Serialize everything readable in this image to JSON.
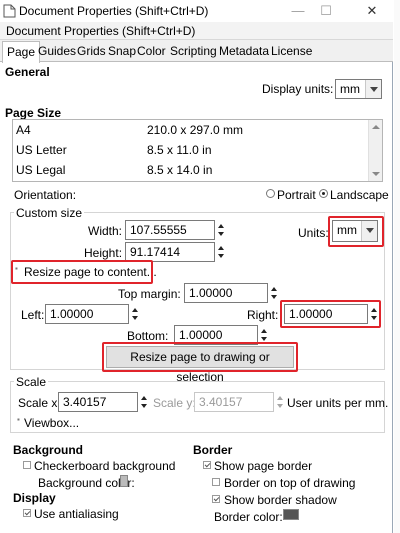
{
  "window": {
    "title": "Document Properties (Shift+Ctrl+D)",
    "subtitle": "Document Properties (Shift+Ctrl+D)",
    "minimize": "—",
    "maximize": "☐",
    "close": "✕"
  },
  "tabs": [
    "Page",
    "Guides",
    "Grids",
    "Snap",
    "Color",
    "Scripting",
    "Metadata",
    "License"
  ],
  "general": {
    "heading": "General",
    "display_units_label": "Display units:",
    "display_units_value": "mm"
  },
  "page_size": {
    "heading": "Page Size",
    "rows": [
      {
        "name": "A4",
        "size": "210.0 x 297.0 mm"
      },
      {
        "name": "US Letter",
        "size": "8.5 x 11.0 in"
      },
      {
        "name": "US Legal",
        "size": "8.5 x 14.0 in"
      }
    ],
    "orientation_label": "Orientation:",
    "portrait": "Portrait",
    "landscape": "Landscape"
  },
  "custom_size": {
    "legend": "Custom size",
    "width_label": "Width:",
    "width_value": "107.55555",
    "height_label": "Height:",
    "height_value": "91.17414",
    "units_label": "Units:",
    "units_value": "mm",
    "resize_expander": "Resize page to content...",
    "top_margin_label": "Top margin:",
    "top_margin_value": "1.00000",
    "left_label": "Left:",
    "left_value": "1.00000",
    "right_label": "Right:",
    "right_value": "1.00000",
    "bottom_label": "Bottom:",
    "bottom_value": "1.00000",
    "resize_button": "Resize page to drawing or selection"
  },
  "scale": {
    "legend": "Scale",
    "scale_x_label": "Scale x:",
    "scale_x_value": "3.40157",
    "scale_y_label": "Scale y:",
    "scale_y_value": "3.40157",
    "units_text": "User units per mm.",
    "viewbox": "Viewbox..."
  },
  "background": {
    "heading": "Background",
    "checkerboard": "Checkerboard background",
    "color_label": "Background color:"
  },
  "border": {
    "heading": "Border",
    "show_border": "Show page border",
    "on_top": "Border on top of drawing",
    "shadow": "Show border shadow",
    "color_label": "Border color:"
  },
  "display": {
    "heading": "Display",
    "antialiasing": "Use antialiasing"
  },
  "colors": {
    "highlight": "#e0242b",
    "border_swatch": "#555555",
    "background_swatch": "#bbbbbb"
  }
}
